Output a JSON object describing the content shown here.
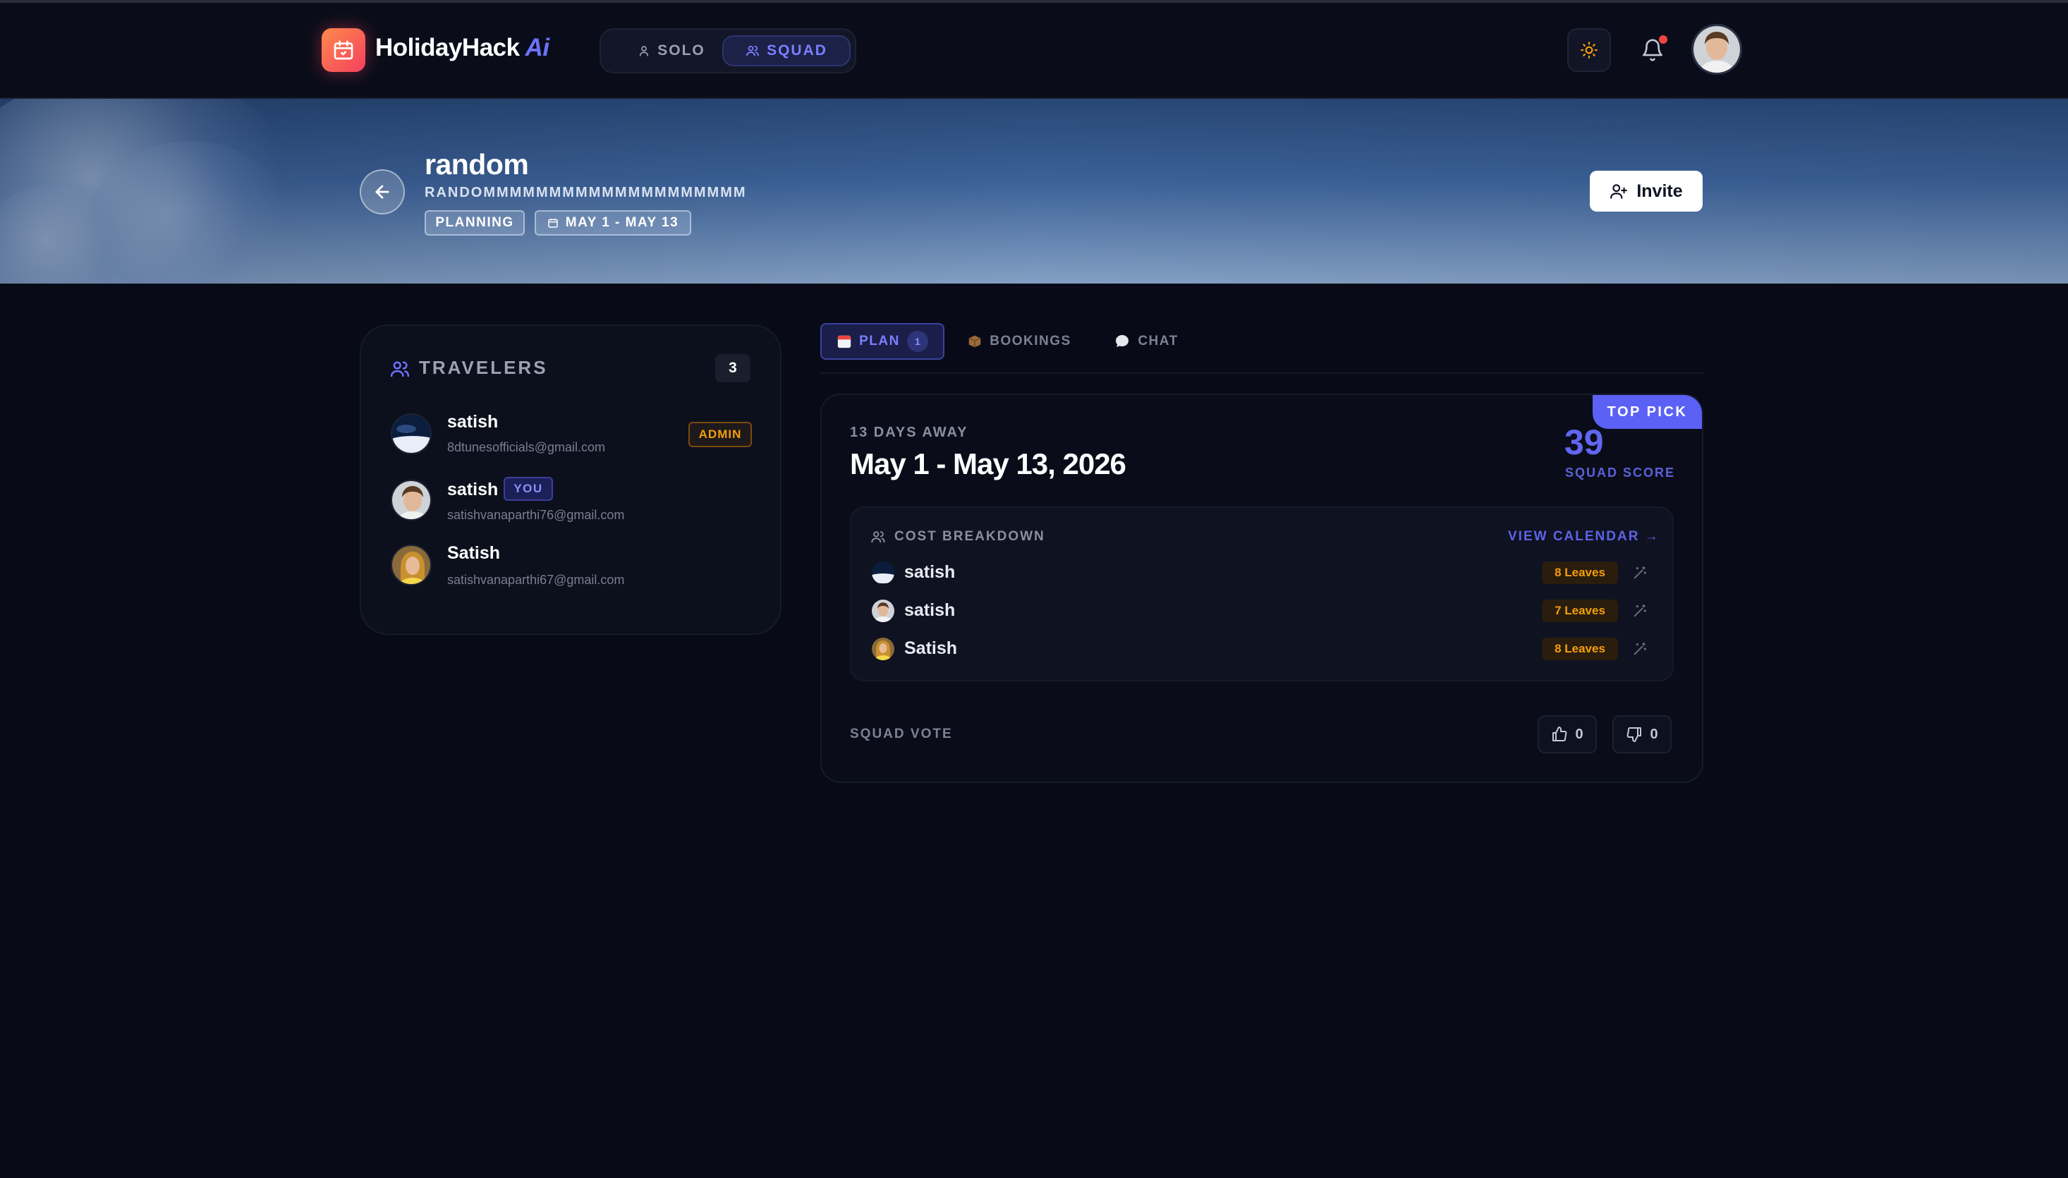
{
  "app": {
    "brand_name": "HolidayHack",
    "brand_suffix": "Ai",
    "accent_color": "#5b61f5",
    "logo_icon": "calendar-icon"
  },
  "header": {
    "modes": [
      {
        "label": "SOLO",
        "icon": "user-icon",
        "active": false
      },
      {
        "label": "SQUAD",
        "icon": "users-icon",
        "active": true
      }
    ],
    "theme_icon": "sun-icon",
    "notification_icon": "bell-icon",
    "has_unread": true
  },
  "trip": {
    "title": "random",
    "subtitle": "RANDOMMMMMMMMMMMMMMMMMMMM",
    "status": "PLANNING",
    "dates": "MAY 1 - MAY 13",
    "invite_label": "Invite"
  },
  "travelers": {
    "heading": "TRAVELERS",
    "count": "3",
    "members": [
      {
        "name": "satish",
        "email": "8dtunesofficials@gmail.com",
        "badge": "ADMIN"
      },
      {
        "name": "satish",
        "email": "satishvanaparthi76@gmail.com",
        "badge": "YOU"
      },
      {
        "name": "Satish",
        "email": "satishvanaparthi67@gmail.com",
        "badge": ""
      }
    ]
  },
  "tabs": [
    {
      "label": "PLAN",
      "icon": "calendar-emoji-icon",
      "count": "1",
      "active": true
    },
    {
      "label": "BOOKINGS",
      "icon": "package-emoji-icon",
      "active": false
    },
    {
      "label": "CHAT",
      "icon": "speech-bubble-emoji-icon",
      "active": false
    }
  ],
  "plan": {
    "ribbon": "TOP PICK",
    "days_away": "13 DAYS AWAY",
    "date_range": "May 1 - May 13, 2026",
    "squad_score": "39",
    "squad_score_label": "SQUAD SCORE",
    "cost_breakdown": {
      "title": "COST BREAKDOWN",
      "link": "VIEW CALENDAR →",
      "rows": [
        {
          "name": "satish",
          "leaves": "8 Leaves"
        },
        {
          "name": "satish",
          "leaves": "7 Leaves"
        },
        {
          "name": "Satish",
          "leaves": "8 Leaves"
        }
      ]
    },
    "vote": {
      "label": "SQUAD VOTE",
      "up": "0",
      "down": "0"
    }
  }
}
